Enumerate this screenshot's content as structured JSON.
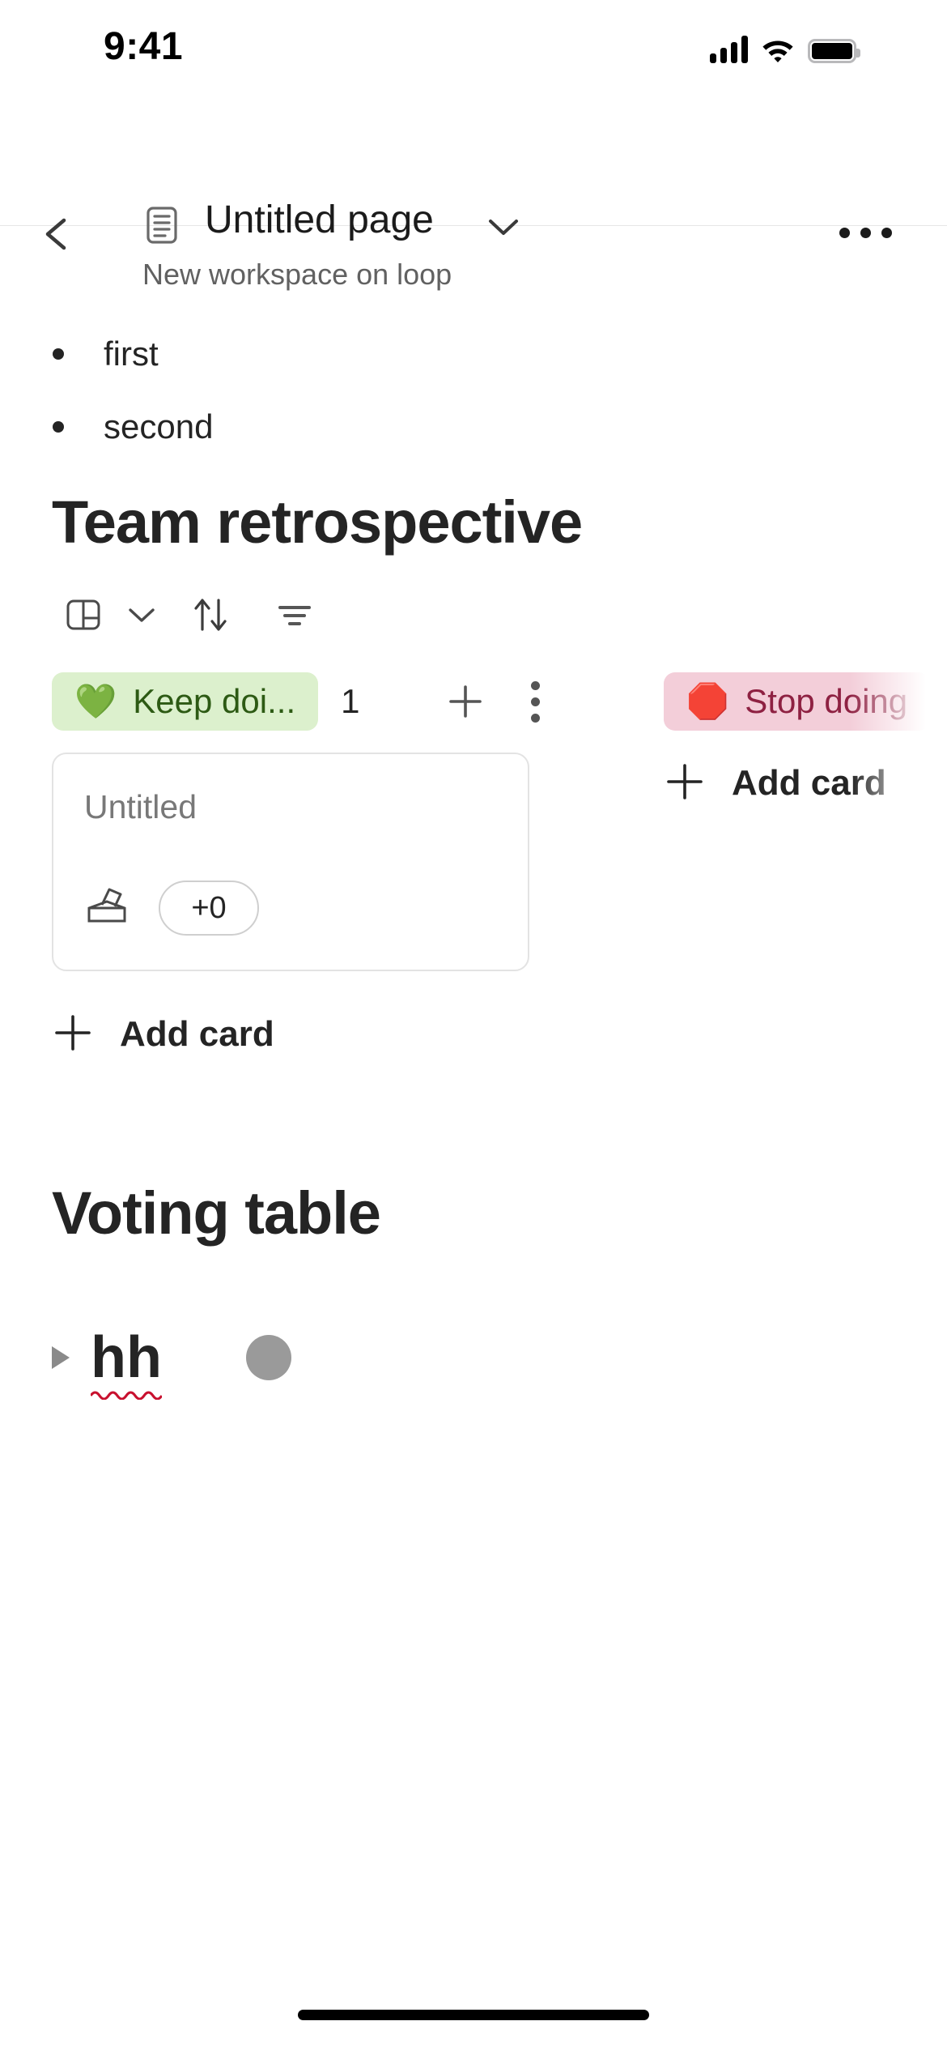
{
  "status_bar": {
    "time": "9:41",
    "icons": [
      "cellular-signal-icon",
      "wifi-icon",
      "battery-icon"
    ]
  },
  "header": {
    "back_icon": "chevron-left-icon",
    "doc_icon": "document-icon",
    "title": "Untitled page",
    "title_chevron_icon": "chevron-down-icon",
    "subtitle": "New workspace on loop",
    "more_icon": "more-horizontal-icon"
  },
  "document": {
    "bullets": [
      {
        "text": "first"
      },
      {
        "text": "second"
      }
    ],
    "board_section": {
      "heading": "Team retrospective",
      "toolbar": [
        {
          "name": "board-view-icon",
          "label": "Board view"
        },
        {
          "name": "chevron-down-icon",
          "label": "Change view"
        },
        {
          "name": "sort-icon",
          "label": "Sort"
        },
        {
          "name": "filter-icon",
          "label": "Filter"
        }
      ],
      "columns": [
        {
          "emoji": "💚",
          "label": "Keep doi...",
          "count": "1",
          "pill_bg": "#dcf0cd",
          "pill_fg": "#2d5a14",
          "add_icon": "plus-icon",
          "menu_icon": "more-vertical-icon",
          "cards": [
            {
              "title": "Untitled",
              "vote_icon": "ballot-box-icon",
              "vote_count": "+0"
            }
          ],
          "add_card_label": "Add card"
        },
        {
          "emoji": "🛑",
          "label": "Stop doing",
          "count": "",
          "pill_bg": "#f3ced9",
          "pill_fg": "#8e2142",
          "cards": [],
          "add_card_label": "Add card"
        }
      ]
    },
    "voting_section": {
      "heading": "Voting table",
      "rows": [
        {
          "caret_icon": "caret-right-icon",
          "text": "hh",
          "misspelled": true,
          "avatar": "gray-avatar"
        }
      ]
    }
  },
  "colors": {
    "text_primary": "#242424",
    "text_secondary": "#616161",
    "placeholder": "#787878",
    "border": "#e3e3e3",
    "green_pill": "#dcf0cd",
    "pink_pill": "#f3ced9",
    "avatar_gray": "#9a9a9a",
    "spellcheck_red": "#c8102e"
  },
  "home_indicator": "home-indicator"
}
